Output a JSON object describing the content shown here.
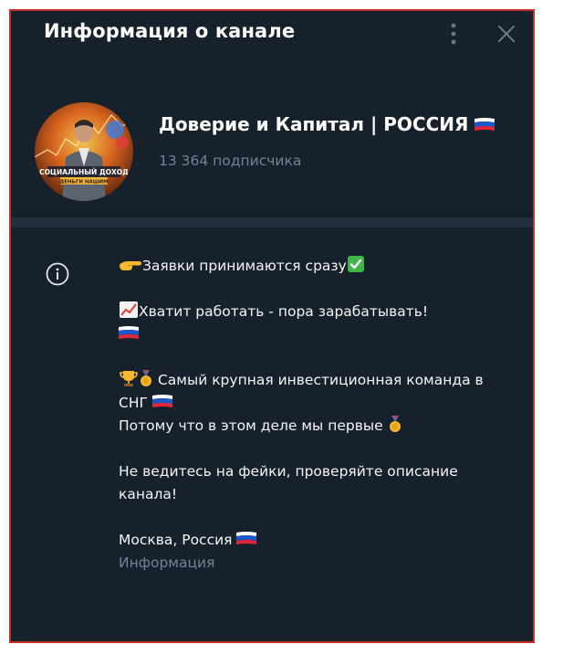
{
  "header": {
    "title": "Информация о канале",
    "more_icon": "more-vertical-icon",
    "close_icon": "close-icon"
  },
  "channel": {
    "name": "Доверие и Капитал | РОССИЯ",
    "subscribers": "13 364 подписчика",
    "avatar_text_top": "СОЦИАЛЬНЫЙ ДОХОД",
    "avatar_text_bottom": "ДЕНЬГИ НАШИМ"
  },
  "description": {
    "line1": "Заявки принимаются сразу",
    "line2": "Хватит работать - пора зарабатывать!",
    "line3a": "Самый крупная инвестиционная команда в СНГ",
    "line3b": "Потому что в этом деле мы первые",
    "line4": "Не ведитесь на фейки, проверяйте описание канала!",
    "line5": "Москва, Россия",
    "label": "Информация"
  },
  "colors": {
    "background": "#17212b",
    "divider": "#232e3c",
    "muted_text": "#708499",
    "border": "#c9302c"
  }
}
